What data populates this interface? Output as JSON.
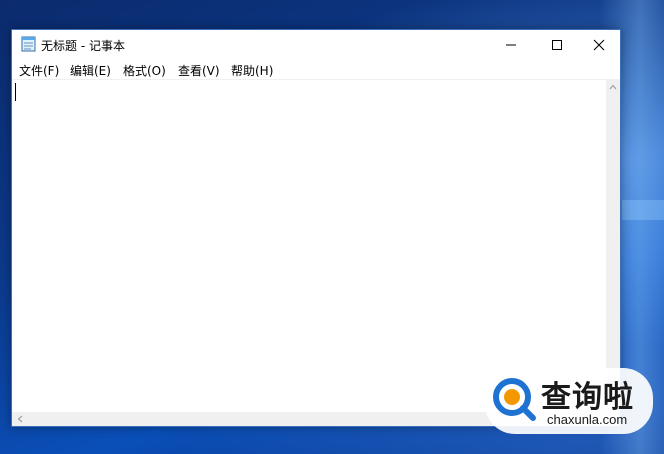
{
  "window": {
    "title": "无标题 - 记事本",
    "controls": {
      "minimize": "minimize",
      "maximize": "maximize",
      "close": "close"
    }
  },
  "menubar": {
    "items": [
      {
        "label": "文件(F)"
      },
      {
        "label": "编辑(E)"
      },
      {
        "label": "格式(O)"
      },
      {
        "label": "查看(V)"
      },
      {
        "label": "帮助(H)"
      }
    ]
  },
  "editor": {
    "content": ""
  },
  "watermark": {
    "brand_cn": "查询啦",
    "brand_en": "chaxunla.com"
  },
  "colors": {
    "desktop_blue": "#0c3a8c",
    "window_border": "#3b6fb8",
    "watermark_orange": "#f39800",
    "watermark_blue": "#1e73d2"
  }
}
